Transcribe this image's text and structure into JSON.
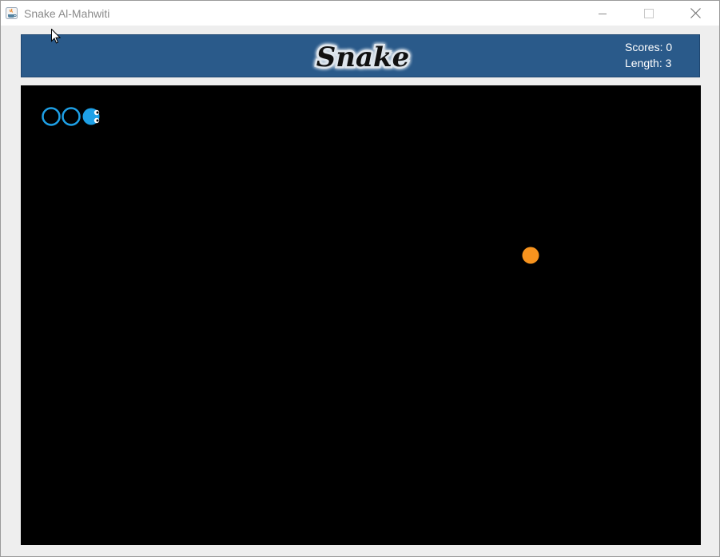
{
  "window": {
    "title": "Snake Al-Mahwiti",
    "icons": [
      "java-app-icon",
      "minimize-icon",
      "maximize-icon",
      "close-icon"
    ]
  },
  "header": {
    "logo_text": "Snake",
    "scores_text": "Scores: 0",
    "length_text": "Length: 3",
    "background_color": "#2a5a8a"
  },
  "game": {
    "score": 0,
    "length": 3,
    "board_color": "#000000",
    "snake_color": "#1ea0e6",
    "food_color": "#f7931e"
  }
}
